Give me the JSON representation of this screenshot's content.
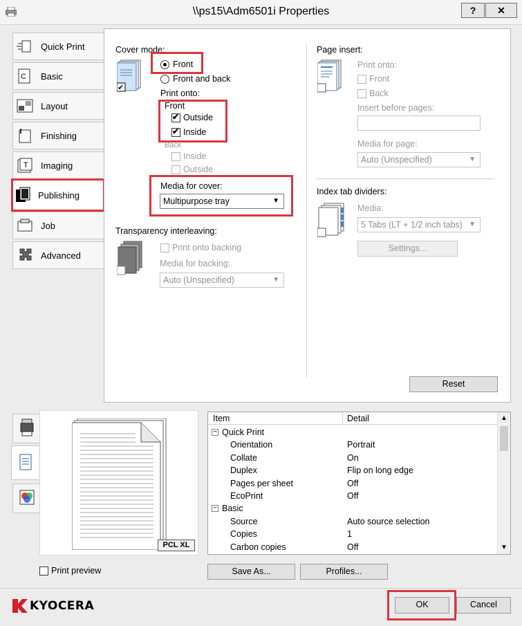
{
  "window": {
    "title": "\\\\ps15\\Adm6501i Properties",
    "help": "?",
    "close": "✕"
  },
  "tabs": [
    {
      "label": "Quick Print",
      "icon": "quick-print-icon"
    },
    {
      "label": "Basic",
      "icon": "basic-icon"
    },
    {
      "label": "Layout",
      "icon": "layout-icon"
    },
    {
      "label": "Finishing",
      "icon": "finishing-icon"
    },
    {
      "label": "Imaging",
      "icon": "imaging-icon"
    },
    {
      "label": "Publishing",
      "icon": "publishing-icon"
    },
    {
      "label": "Job",
      "icon": "job-icon"
    },
    {
      "label": "Advanced",
      "icon": "advanced-icon"
    }
  ],
  "active_tab": "Publishing",
  "cover": {
    "mode_label": "Cover mode:",
    "front": "Front",
    "front_and_back": "Front and back",
    "print_onto": "Print onto:",
    "front_group": "Front",
    "outside": "Outside",
    "inside": "Inside",
    "back_group": "Back",
    "back_inside": "Inside",
    "back_outside": "Outside",
    "media_label": "Media for cover:",
    "media_value": "Multipurpose tray"
  },
  "transparency": {
    "label": "Transparency interleaving:",
    "print_backing": "Print onto backing",
    "media_backing_label": "Media for backing:",
    "media_backing_value": "Auto (Unspecified)"
  },
  "page_insert": {
    "label": "Page insert:",
    "print_onto": "Print onto:",
    "front": "Front",
    "back": "Back",
    "insert_before": "Insert before pages:",
    "insert_value": "",
    "media_label": "Media for page:",
    "media_value": "Auto (Unspecified)"
  },
  "index_tab": {
    "label": "Index tab dividers:",
    "media_label": "Media:",
    "media_value": "5 Tabs (LT + 1/2 inch tabs)",
    "settings": "Settings..."
  },
  "reset": "Reset",
  "preview": {
    "badge": "PCL XL",
    "print_preview": "Print preview"
  },
  "summary": {
    "col_item": "Item",
    "col_detail": "Detail",
    "rows": [
      {
        "type": "group",
        "item": "Quick Print",
        "detail": ""
      },
      {
        "type": "item",
        "item": "Orientation",
        "detail": "Portrait"
      },
      {
        "type": "item",
        "item": "Collate",
        "detail": "On"
      },
      {
        "type": "item",
        "item": "Duplex",
        "detail": "Flip on long edge"
      },
      {
        "type": "item",
        "item": "Pages per sheet",
        "detail": "Off"
      },
      {
        "type": "item",
        "item": "EcoPrint",
        "detail": "Off"
      },
      {
        "type": "group",
        "item": "Basic",
        "detail": ""
      },
      {
        "type": "item",
        "item": "Source",
        "detail": "Auto source selection"
      },
      {
        "type": "item",
        "item": "Copies",
        "detail": "1"
      },
      {
        "type": "item",
        "item": "Carbon copies",
        "detail": "Off"
      }
    ]
  },
  "footer": {
    "save_as": "Save As...",
    "profiles": "Profiles...",
    "brand": "KYOCERA",
    "ok": "OK",
    "cancel": "Cancel"
  },
  "colors": {
    "highlight": "#d9363e",
    "brand": "#d42027"
  }
}
